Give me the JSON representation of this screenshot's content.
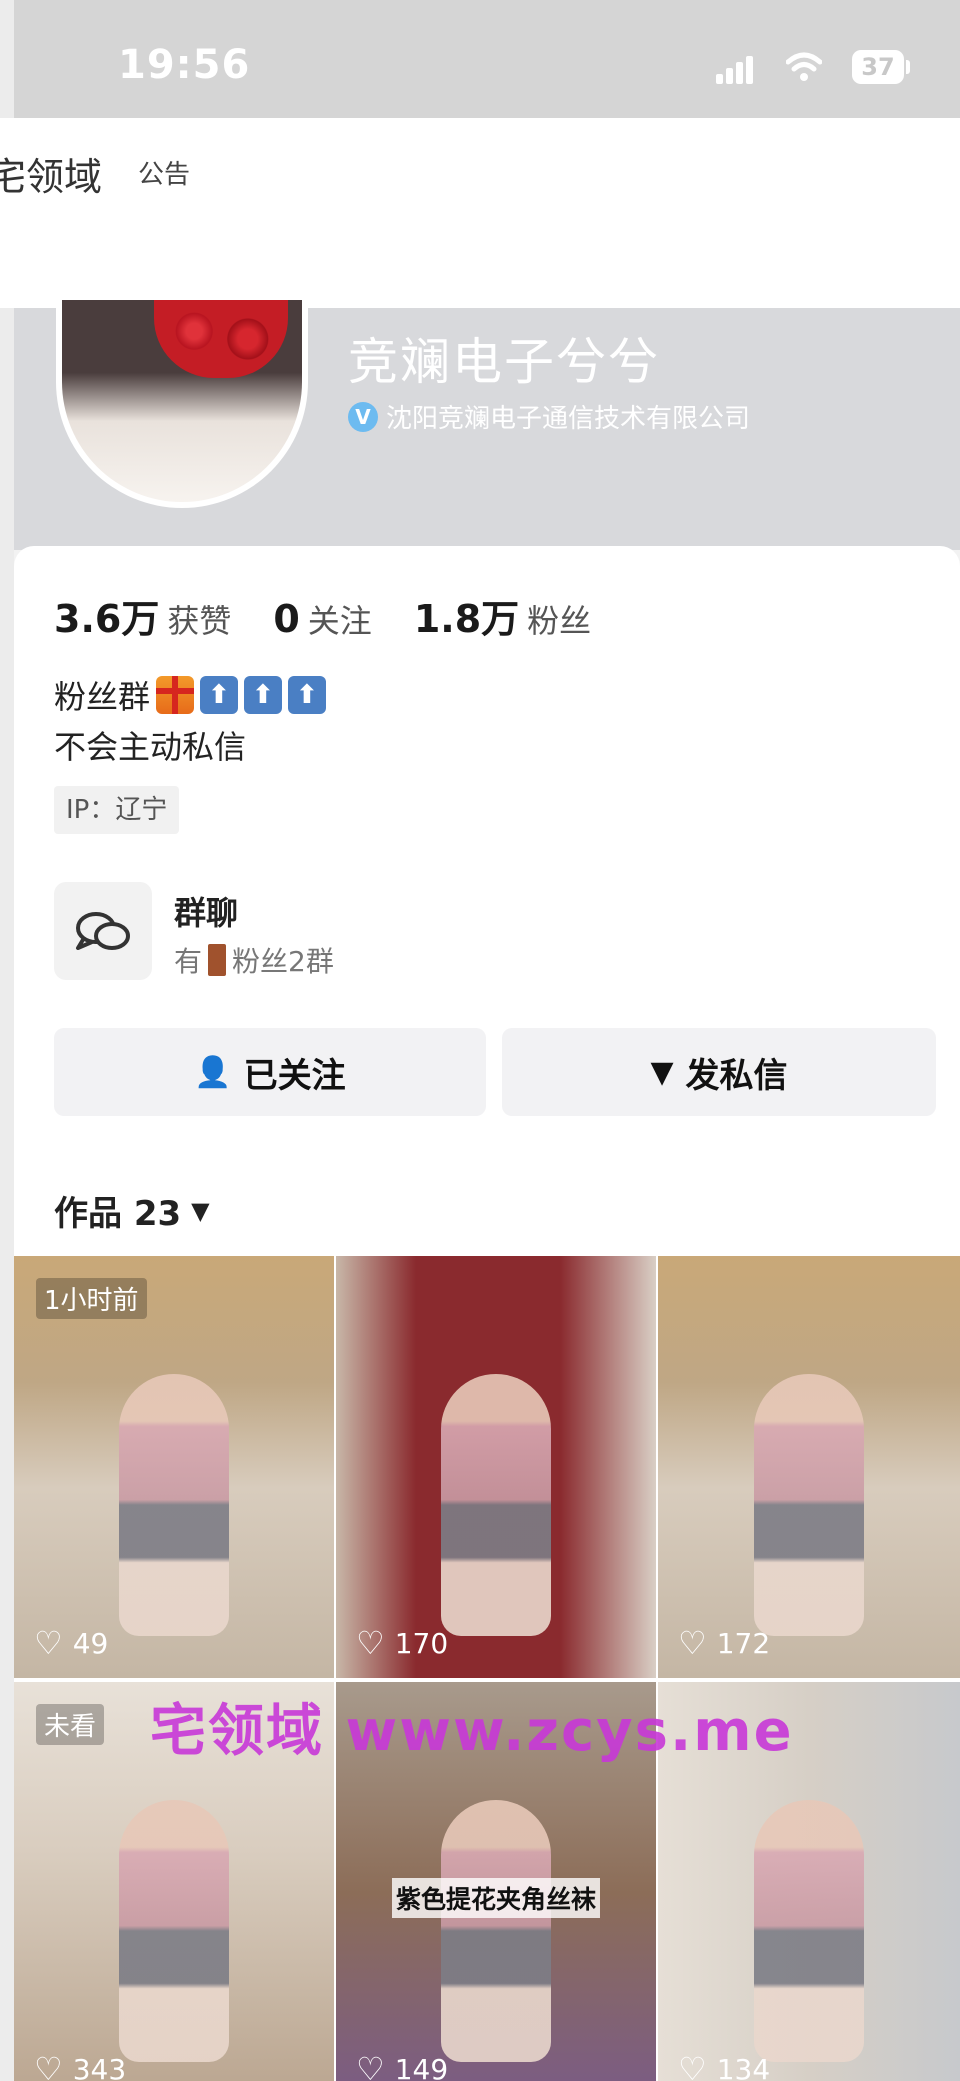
{
  "status_bar": {
    "time": "19:56",
    "battery": "37"
  },
  "topbar": {
    "title": "宅领域",
    "notice": "公告"
  },
  "profile": {
    "name": "竞斓电子兮兮",
    "verified_badge": "V",
    "company": "沈阳竞斓电子通信技术有限公司",
    "avatar_icon": "avatar-photo"
  },
  "stats": [
    {
      "value": "3.6万",
      "label": "获赞"
    },
    {
      "value": "0",
      "label": "关注"
    },
    {
      "value": "1.8万",
      "label": "粉丝"
    }
  ],
  "bio": {
    "line1": "粉丝群",
    "line2": "不会主动私信",
    "ip": "IP：辽宁",
    "icons": [
      "gift-icon",
      "up-arrow-icon",
      "up-arrow-icon",
      "up-arrow-icon"
    ]
  },
  "group": {
    "title": "群聊",
    "prefix": "有",
    "subtitle": "粉丝2群",
    "icon": "chat-bubbles-icon"
  },
  "actions": {
    "follow_label": "已关注",
    "message_label": "发私信"
  },
  "works": {
    "label": "作品 23",
    "caret": "▼"
  },
  "tiles": [
    {
      "tag": "1小时前",
      "likes": "49",
      "caption": ""
    },
    {
      "tag": "",
      "likes": "170",
      "caption": ""
    },
    {
      "tag": "",
      "likes": "172",
      "caption": ""
    },
    {
      "tag": "未看",
      "likes": "343",
      "caption": ""
    },
    {
      "tag": "",
      "likes": "149",
      "caption": "紫色提花夹角丝袜"
    },
    {
      "tag": "",
      "likes": "134",
      "caption": ""
    }
  ],
  "watermark": "宅领域 www.zcys.me",
  "colors": {
    "header_bg": "#d8d9dc",
    "verified": "#6dbbf0",
    "watermark": "#c838d8",
    "button_bg": "#f2f2f4"
  }
}
